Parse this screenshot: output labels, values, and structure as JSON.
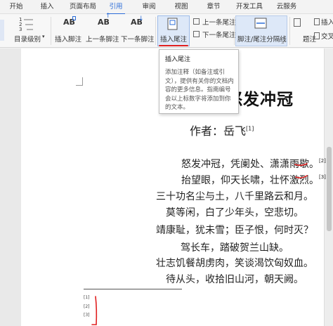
{
  "menu": {
    "tabs": [
      "开始",
      "插入",
      "页面布局",
      "引用",
      "审阅",
      "视图",
      "章节",
      "开发工具",
      "云服务"
    ],
    "active_tab": "引用"
  },
  "ribbon": {
    "toc_level_label": "目录级别",
    "insert_footnote_label": "插入脚注",
    "prev_footnote_label": "上一条脚注",
    "next_footnote_label": "下一条脚注",
    "insert_endnote_label": "插入尾注",
    "prev_endnote_label": "上一条尾注",
    "next_endnote_label": "下一条尾注",
    "separator_label": "脚注/尾注分隔线",
    "caption_label": "题注",
    "insert_label": "插入",
    "cross_ref_label": "交叉",
    "ab_glyph": "AB",
    "numbers_glyph": "1\n2\n3",
    "accent_color": "#2b6cd8"
  },
  "tooltip": {
    "title": "插入尾注",
    "body": "添加注释（如备注或引文），提供有关你的文档内容的更多信息。指南编号会以上标数字将添加到你的文本。"
  },
  "document": {
    "title": "怒发冲冠",
    "author_label": "作者：岳飞",
    "author_mark": "[1]",
    "lines": [
      {
        "text": "怒发冲冠，凭阑处、潇潇雨歇。",
        "mark": "[2]"
      },
      {
        "text": "抬望眼，仰天长啸，壮怀激烈。",
        "mark": "[3]"
      },
      {
        "text": "三十功名尘与土，八千里路云和月。",
        "mark": ""
      },
      {
        "text": "莫等闲，白了少年头，空悲切。",
        "mark": ""
      },
      {
        "text": "靖康耻，犹未雪；臣子恨，何时灭？",
        "mark": ""
      },
      {
        "text": "驾长车，踏破贺兰山缺。",
        "mark": ""
      },
      {
        "text": "壮志饥餐胡虏肉，笑谈渴饮匈奴血。",
        "mark": ""
      },
      {
        "text": "待从头，收拾旧山河，朝天阙。",
        "mark": ""
      }
    ],
    "footnotes": [
      "[1]",
      "[2]",
      "[3]"
    ]
  }
}
